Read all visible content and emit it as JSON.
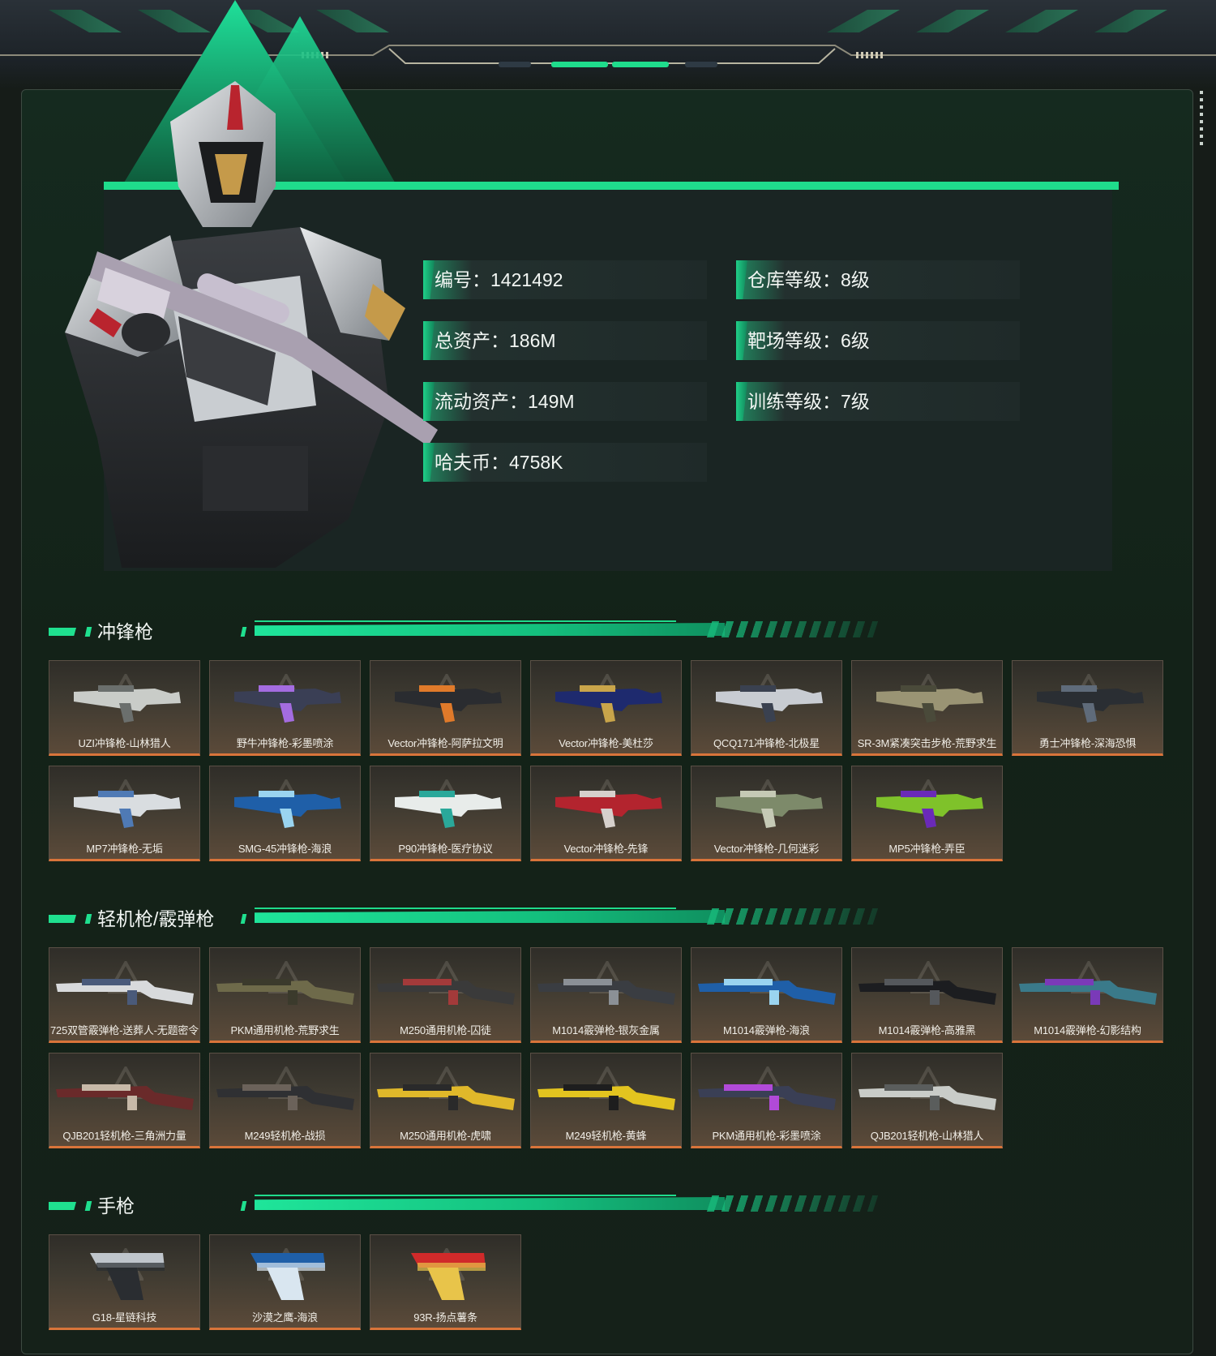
{
  "stats": {
    "id": "编号：1421492",
    "total_assets": "总资产：186M",
    "liquid_assets": "流动资产：149M",
    "haf_coins": "哈夫币：4758K",
    "warehouse_level": "仓库等级：8级",
    "range_level": "靶场等级：6级",
    "training_level": "训练等级：7级"
  },
  "colors": {
    "accent": "#1fdc8c",
    "card_border": "#d9743a",
    "background": "#161c18"
  },
  "sections": [
    {
      "title": "冲锋枪",
      "items": [
        {
          "name": "UZI冲锋枪-山林猎人",
          "colors": [
            "#c9ccc8",
            "#6b6f6d"
          ]
        },
        {
          "name": "野牛冲锋枪-彩墨喷涂",
          "colors": [
            "#3a3f55",
            "#a46ce0"
          ]
        },
        {
          "name": "Vector冲锋枪-阿萨拉文明",
          "colors": [
            "#2a2c30",
            "#e07a2a"
          ]
        },
        {
          "name": "Vector冲锋枪-美杜莎",
          "colors": [
            "#1e2a6e",
            "#c9a54a"
          ]
        },
        {
          "name": "QCQ171冲锋枪-北极星",
          "colors": [
            "#c8ccd2",
            "#3a4150"
          ]
        },
        {
          "name": "SR-3M紧凑突击步枪-荒野求生",
          "colors": [
            "#9a9474",
            "#4a4a3a"
          ]
        },
        {
          "name": "勇士冲锋枪-深海恐惧",
          "colors": [
            "#2a2e33",
            "#5f6b7a"
          ]
        },
        {
          "name": "MP7冲锋枪-无垢",
          "colors": [
            "#d9dde0",
            "#4f7ab5"
          ]
        },
        {
          "name": "SMG-45冲锋枪-海浪",
          "colors": [
            "#1f5fa8",
            "#9ad4f0"
          ]
        },
        {
          "name": "P90冲锋枪-医疗协议",
          "colors": [
            "#e8ecea",
            "#2aa89a"
          ]
        },
        {
          "name": "Vector冲锋枪-先锋",
          "colors": [
            "#b3242e",
            "#d6d0cc"
          ]
        },
        {
          "name": "Vector冲锋枪-几何迷彩",
          "colors": [
            "#7d8a6a",
            "#c5c9b5"
          ]
        },
        {
          "name": "MP5冲锋枪-弄臣",
          "colors": [
            "#7fc22a",
            "#6a2ab8"
          ]
        }
      ]
    },
    {
      "title": "轻机枪/霰弹枪",
      "items": [
        {
          "name": "725双管霰弹枪-送葬人-无题密令",
          "colors": [
            "#d8dadc",
            "#4a5a7a"
          ]
        },
        {
          "name": "PKM通用机枪-荒野求生",
          "colors": [
            "#6e6a4a",
            "#3b3a2c"
          ]
        },
        {
          "name": "M250通用机枪-囚徒",
          "colors": [
            "#3a3a3a",
            "#a33a3a"
          ]
        },
        {
          "name": "M1014霰弹枪-银灰金属",
          "colors": [
            "#3a3d42",
            "#8b9096"
          ]
        },
        {
          "name": "M1014霰弹枪-海浪",
          "colors": [
            "#1f5fa8",
            "#9ad4f0"
          ]
        },
        {
          "name": "M1014霰弹枪-高雅黑",
          "colors": [
            "#1c1d20",
            "#55585c"
          ]
        },
        {
          "name": "M1014霰弹枪-幻影结构",
          "colors": [
            "#3a7a8a",
            "#7a3ab8"
          ]
        },
        {
          "name": "QJB201轻机枪-三角洲力量",
          "colors": [
            "#6a2a2a",
            "#c7b9a8"
          ]
        },
        {
          "name": "M249轻机枪-战损",
          "colors": [
            "#2f3033",
            "#6b625a"
          ]
        },
        {
          "name": "M250通用机枪-虎啸",
          "colors": [
            "#e0b82a",
            "#2a2a2a"
          ]
        },
        {
          "name": "M249轻机枪-黄蜂",
          "colors": [
            "#e3c41f",
            "#1e1e1e"
          ]
        },
        {
          "name": "PKM通用机枪-彩墨喷涂",
          "colors": [
            "#3a3f55",
            "#b14ad8"
          ]
        },
        {
          "name": "QJB201轻机枪-山林猎人",
          "colors": [
            "#c9ccc8",
            "#5a5d5c"
          ]
        }
      ]
    },
    {
      "title": "手枪",
      "items": [
        {
          "name": "G18-星链科技",
          "colors": [
            "#bfc5cb",
            "#2a2d31"
          ]
        },
        {
          "name": "沙漠之鹰-海浪",
          "colors": [
            "#1f5fa8",
            "#d9e6f0"
          ]
        },
        {
          "name": "93R-扬点薯条",
          "colors": [
            "#d02a2a",
            "#e8c44a"
          ]
        }
      ]
    }
  ]
}
